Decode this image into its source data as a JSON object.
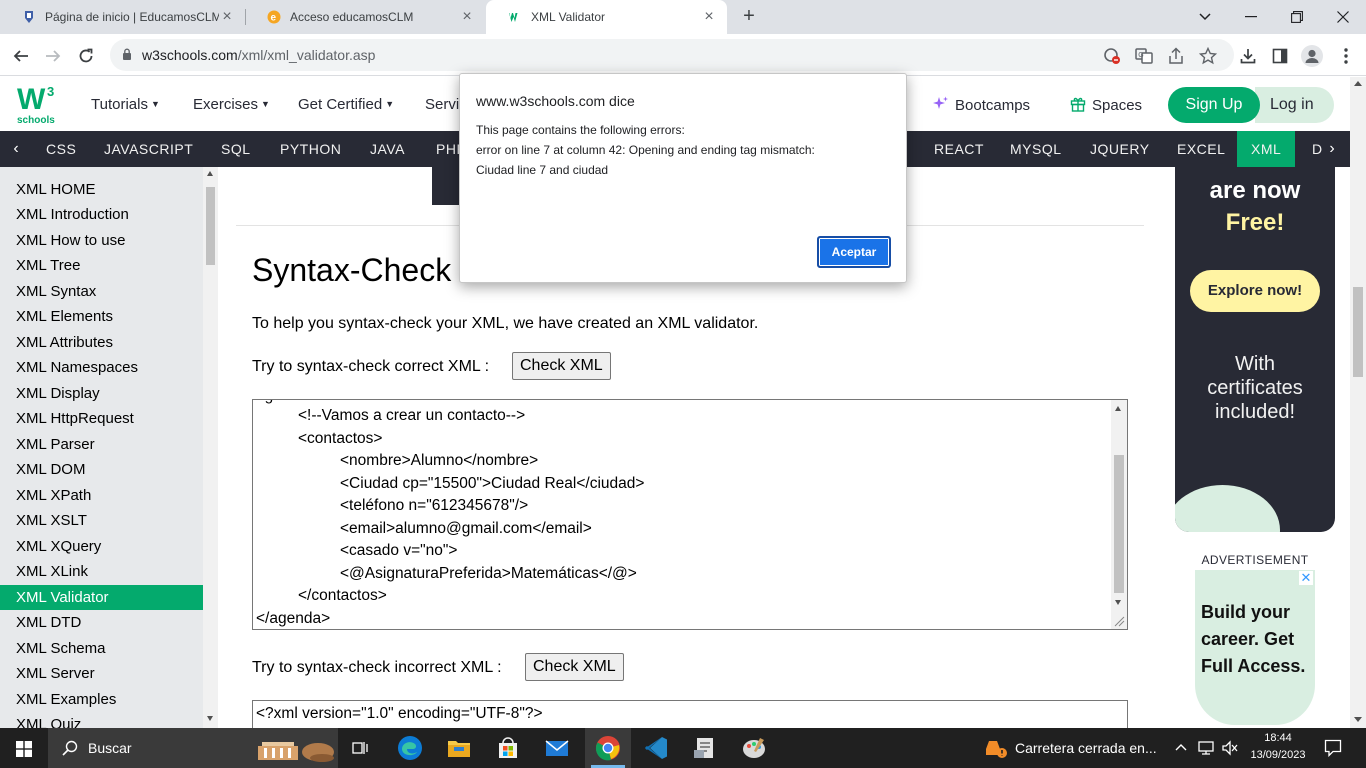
{
  "browser": {
    "tabs": [
      {
        "title": "Página de inicio | EducamosCLM",
        "favicon": "educamos-shield-icon"
      },
      {
        "title": "Acceso educamosCLM",
        "favicon": "educamos-e-icon"
      },
      {
        "title": "XML Validator",
        "favicon": "w3schools-icon"
      }
    ],
    "url_host": "w3schools.com",
    "url_path": "/xml/xml_validator.asp"
  },
  "w3nav": {
    "logo_text": "schools",
    "logo_sup": "3",
    "logo_w": "W",
    "links": [
      "Tutorials",
      "Exercises",
      "Get Certified",
      "Servi"
    ],
    "bootcamps": "Bootcamps",
    "spaces": "Spaces",
    "signup": "Sign Up",
    "login": "Log in"
  },
  "topics": [
    "CSS",
    "JAVASCRIPT",
    "SQL",
    "PYTHON",
    "JAVA",
    "PHP",
    "REACT",
    "MYSQL",
    "JQUERY",
    "EXCEL",
    "XML",
    "D"
  ],
  "topic_active": "XML",
  "sidebar": {
    "items": [
      "XML HOME",
      "XML Introduction",
      "XML How to use",
      "XML Tree",
      "XML Syntax",
      "XML Elements",
      "XML Attributes",
      "XML Namespaces",
      "XML Display",
      "XML HttpRequest",
      "XML Parser",
      "XML DOM",
      "XML XPath",
      "XML XSLT",
      "XML XQuery",
      "XML XLink",
      "XML Validator",
      "XML DTD",
      "XML Schema",
      "XML Server",
      "XML Examples",
      "XML Quiz"
    ],
    "active": "XML Validator"
  },
  "main": {
    "heading": "Syntax-Check Y",
    "intro": "To help you syntax-check your XML, we have created an XML validator.",
    "correct_label": "Try to syntax-check correct XML :",
    "check_button": "Check XML",
    "incorrect_label": "Try to syntax-check incorrect XML :",
    "code_lines": [
      "<!--Vamos a crear un contacto-->",
      "<contactos>",
      "<nombre>Alumno</nombre>",
      "<Ciudad cp=\"15500\">Ciudad Real</ciudad>",
      "<teléfono n=\"612345678\"/>",
      "<email>alumno@gmail.com</email>",
      "<casado v=\"no\">",
      "<@AsignaturaPreferida>Matemáticas</@>",
      "</contactos>",
      "</agenda>"
    ],
    "code2_first_line": "<?xml version=\"1.0\" encoding=\"UTF-8\"?>"
  },
  "ads": {
    "line1": "are now",
    "line2": "Free!",
    "explore": "Explore now!",
    "with_certs": [
      "With",
      "certificates",
      "included!"
    ],
    "advert_label": "ADVERTISEMENT",
    "ad2_text": "Build your career. Get Full Access.",
    "ad2_close": "✕"
  },
  "dialog": {
    "title": "www.w3schools.com dice",
    "lines": [
      "This page contains the following errors:",
      "error on line 7 at column 42: Opening and ending tag mismatch:",
      "Ciudad line 7 and ciudad"
    ],
    "ok": "Aceptar"
  },
  "taskbar": {
    "search": "Buscar",
    "news": "Carretera cerrada en...",
    "time": "18:44",
    "date": "13/09/2023"
  },
  "colors": {
    "w3_green": "#04aa6d",
    "topic_bar": "#282a35",
    "dialog_button": "#1a73e8"
  }
}
